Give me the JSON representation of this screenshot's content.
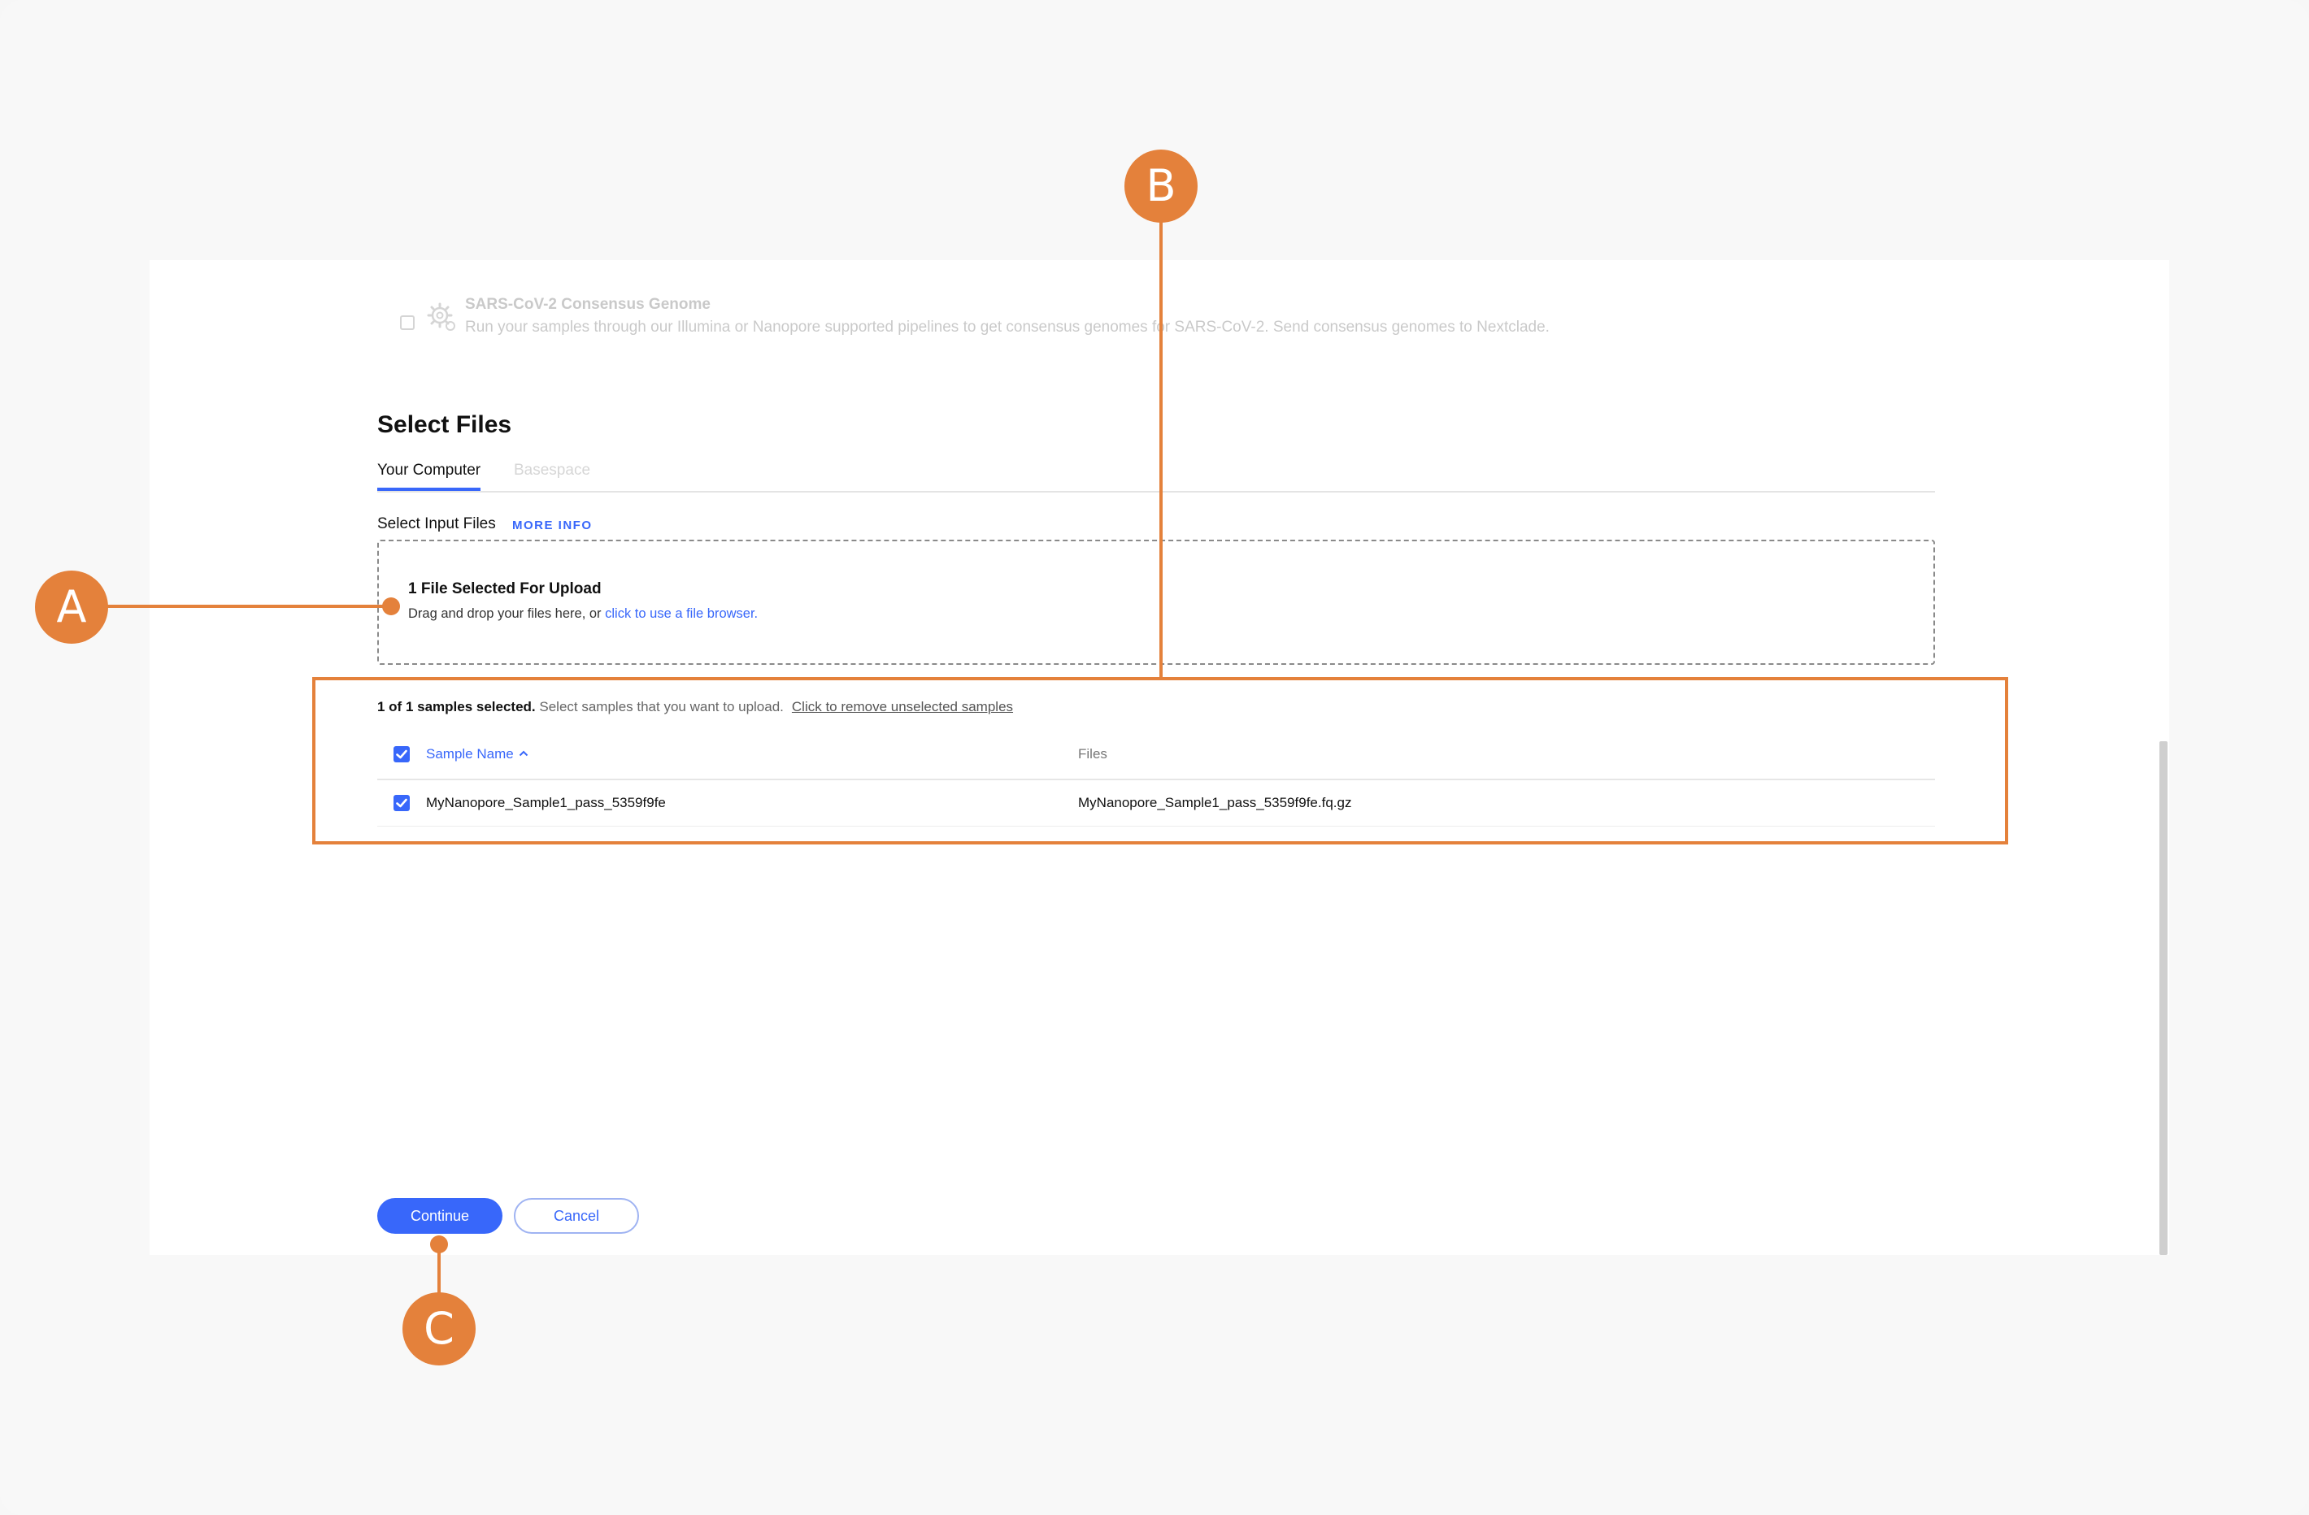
{
  "workflow_option": {
    "title": "SARS-CoV-2 Consensus Genome",
    "description": "Run your samples through our Illumina or Nanopore supported pipelines to get consensus genomes for SARS-CoV-2. Send consensus genomes to Nextclade."
  },
  "section_title": "Select Files",
  "tabs": [
    {
      "label": "Your Computer",
      "active": true
    },
    {
      "label": "Basespace",
      "active": false
    }
  ],
  "input_files": {
    "label": "Select Input Files",
    "more_info": "MORE INFO"
  },
  "dropzone": {
    "title": "1 File Selected For Upload",
    "desc_prefix": "Drag and drop your files here, or ",
    "desc_link": "click to use a file browser."
  },
  "selection_summary": {
    "count_text": "1 of 1 samples selected.",
    "hint": " Select samples that you want to upload.",
    "remove_link": "Click to remove unselected samples"
  },
  "table": {
    "columns": [
      "Sample Name",
      "Files"
    ],
    "rows": [
      {
        "sample_name": "MyNanopore_Sample1_pass_5359f9fe",
        "files": "MyNanopore_Sample1_pass_5359f9fe.fq.gz",
        "selected": true
      }
    ]
  },
  "buttons": {
    "continue": "Continue",
    "cancel": "Cancel"
  },
  "callouts": [
    "A",
    "B",
    "C"
  ],
  "colors": {
    "accent": "#3867fa",
    "annotation": "#e4813b"
  }
}
